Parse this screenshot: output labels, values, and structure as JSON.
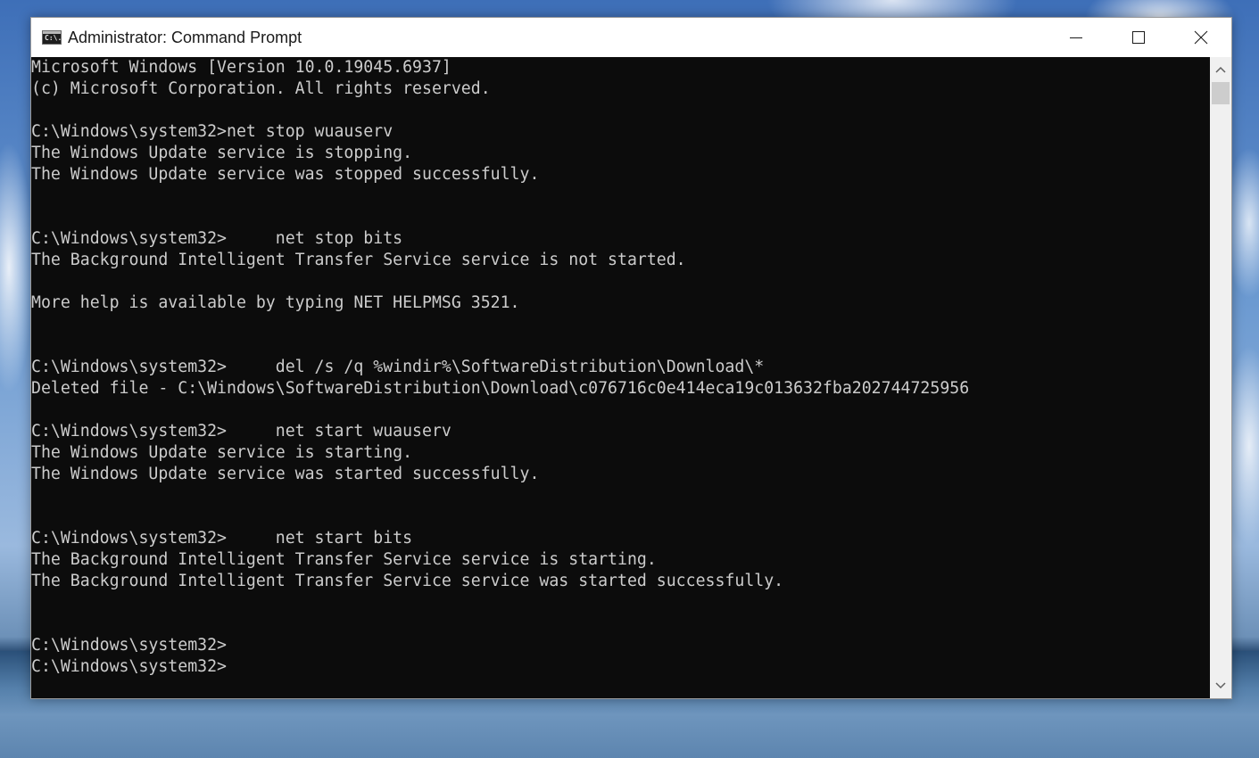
{
  "window": {
    "title": "Administrator: Command Prompt",
    "icon_glyph": "C:\\."
  },
  "icons": {
    "app": "command-prompt-icon",
    "minimize": "minimize-icon",
    "maximize": "maximize-icon",
    "close": "close-icon",
    "scroll_up": "chevron-up-icon",
    "scroll_down": "chevron-down-icon"
  },
  "console": {
    "background": "#0c0c0c",
    "foreground": "#cccccc",
    "lines": [
      "Microsoft Windows [Version 10.0.19045.6937]",
      "(c) Microsoft Corporation. All rights reserved.",
      "",
      "C:\\Windows\\system32>net stop wuauserv",
      "The Windows Update service is stopping.",
      "The Windows Update service was stopped successfully.",
      "",
      "",
      "C:\\Windows\\system32>     net stop bits",
      "The Background Intelligent Transfer Service service is not started.",
      "",
      "More help is available by typing NET HELPMSG 3521.",
      "",
      "",
      "C:\\Windows\\system32>     del /s /q %windir%\\SoftwareDistribution\\Download\\*",
      "Deleted file - C:\\Windows\\SoftwareDistribution\\Download\\c076716c0e414eca19c013632fba202744725956",
      "",
      "C:\\Windows\\system32>     net start wuauserv",
      "The Windows Update service is starting.",
      "The Windows Update service was started successfully.",
      "",
      "",
      "C:\\Windows\\system32>     net start bits",
      "The Background Intelligent Transfer Service service is starting.",
      "The Background Intelligent Transfer Service service was started successfully.",
      "",
      "",
      "C:\\Windows\\system32>",
      "C:\\Windows\\system32>"
    ]
  }
}
